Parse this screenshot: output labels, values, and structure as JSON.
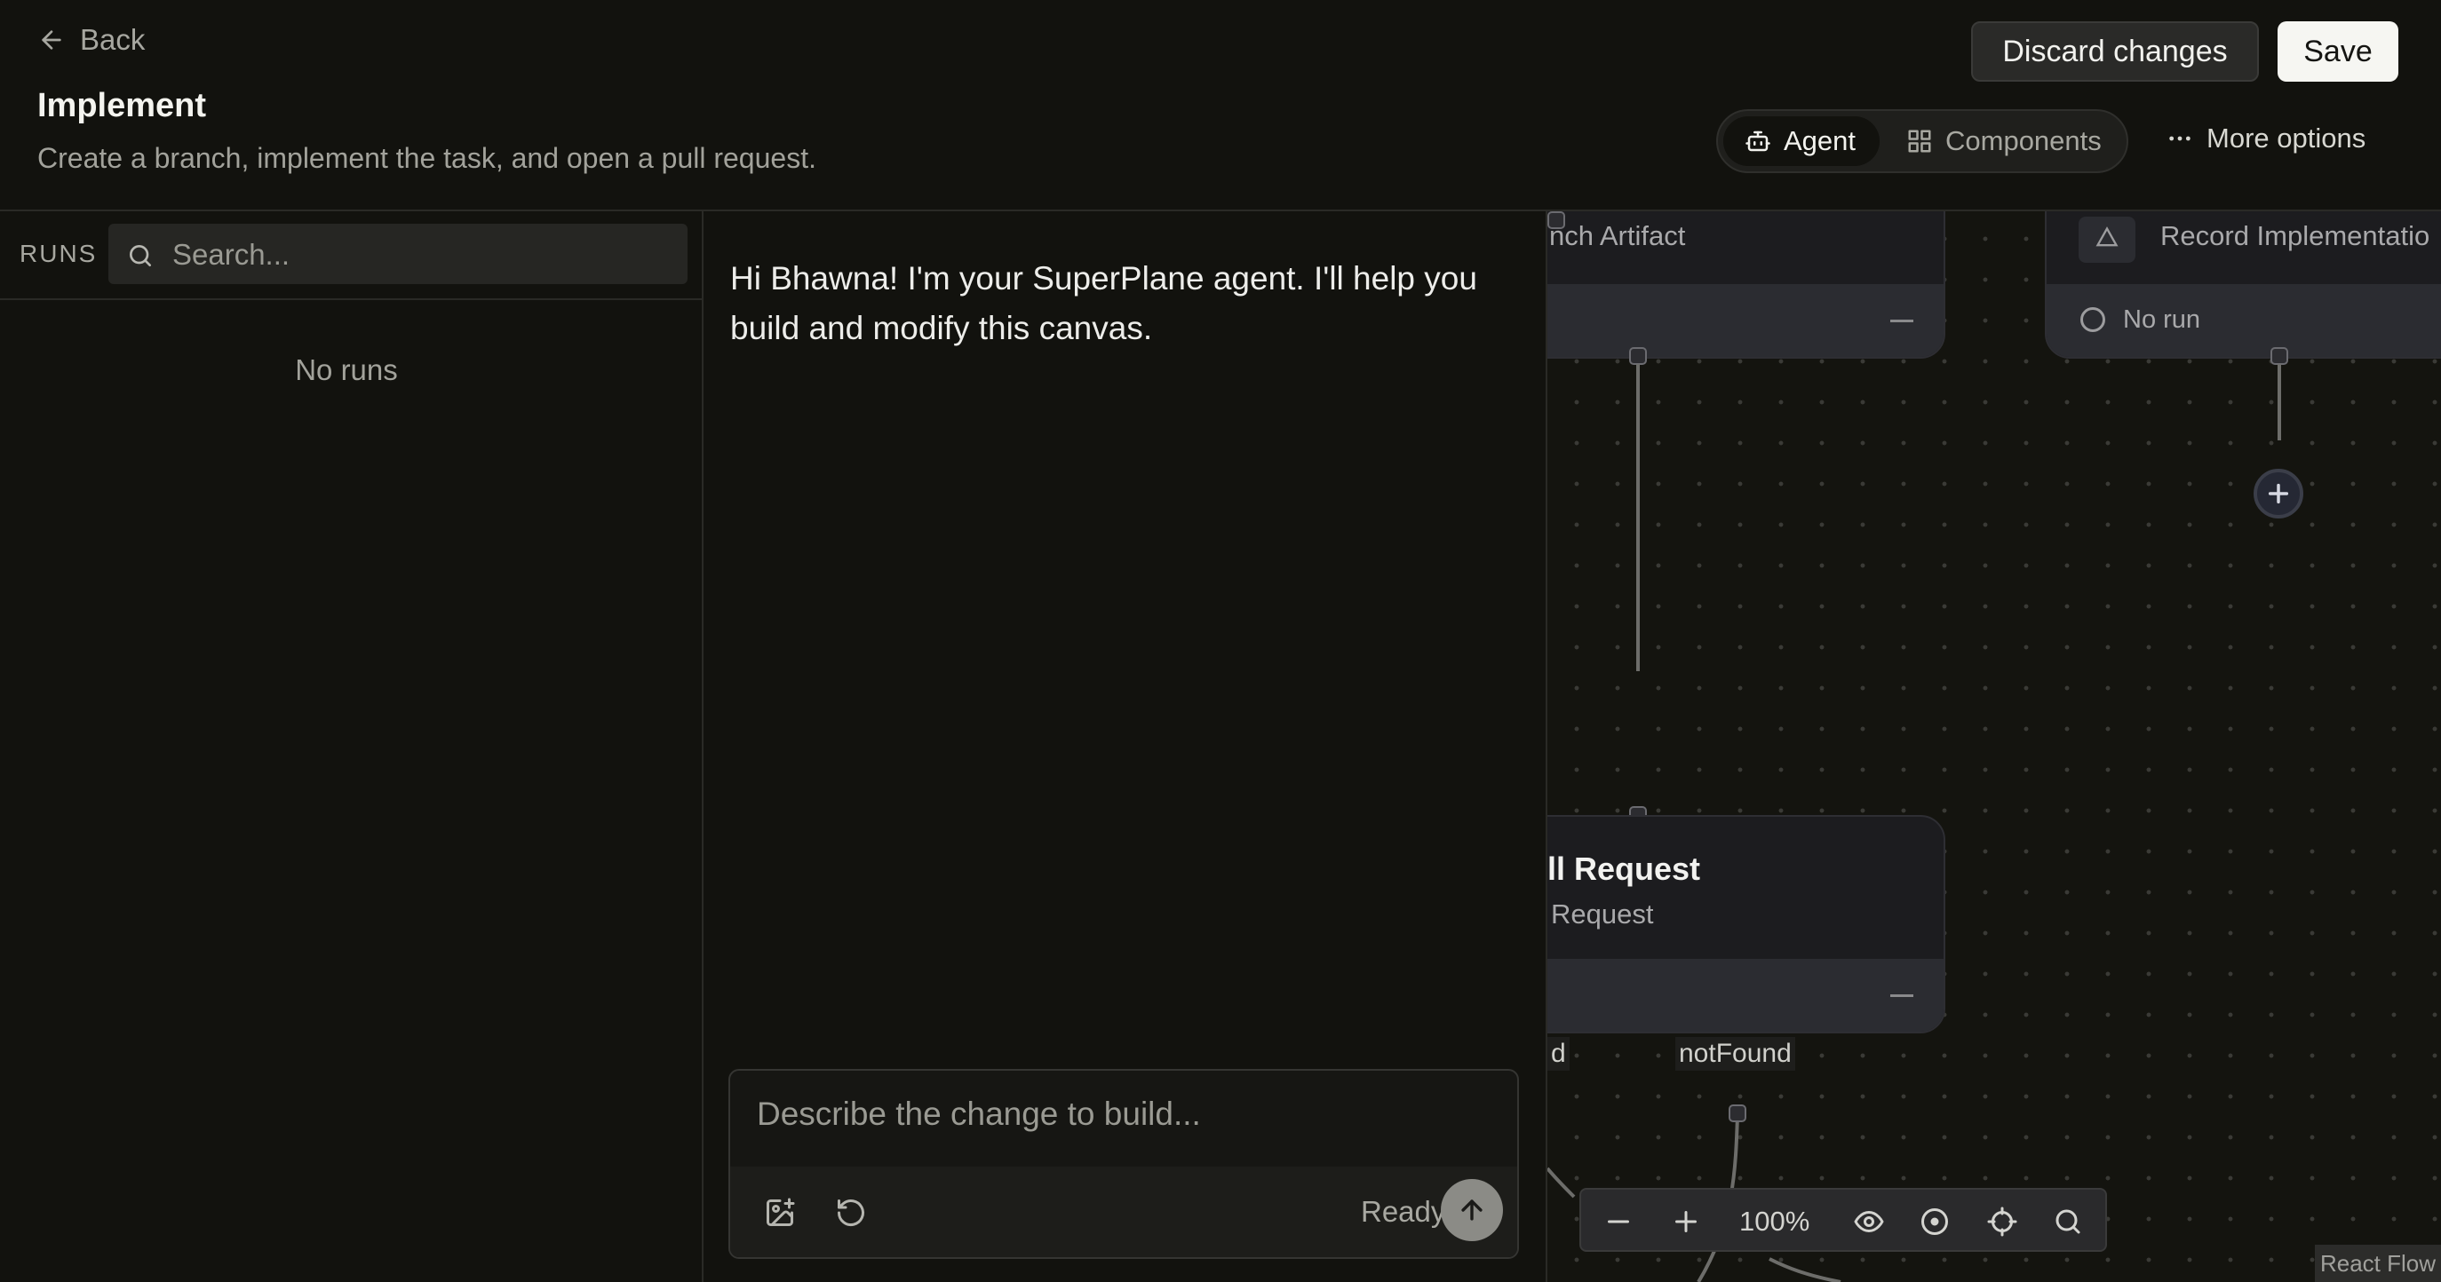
{
  "header": {
    "back_label": "Back",
    "title": "Implement",
    "subtitle": "Create a branch, implement the task, and open a pull request.",
    "discard_label": "Discard changes",
    "save_label": "Save",
    "tabs": [
      {
        "label": "Agent",
        "icon": "bot-icon",
        "active": true
      },
      {
        "label": "Components",
        "icon": "components-icon",
        "active": false
      }
    ],
    "more_label": "More options"
  },
  "runs": {
    "label": "RUNS",
    "search_placeholder": "Search...",
    "empty_text": "No runs"
  },
  "agent": {
    "message": "Hi Bhawna! I'm your SuperPlane agent. I'll help you build and modify this canvas.",
    "composer_placeholder": "Describe the change to build...",
    "status": "Ready"
  },
  "canvas": {
    "nodes": [
      {
        "subtitle": "nch Artifact",
        "footer": "—"
      },
      {
        "subtitle": "Record Implementatio",
        "status": "No run"
      },
      {
        "title": "ll Request",
        "subtitle": "Request",
        "footer": "—"
      }
    ],
    "edge_labels": [
      "d",
      "notFound"
    ],
    "zoom_level": "100%",
    "attribution": "React Flow"
  },
  "colors": {
    "background": "#12120e",
    "canvas_node": "#1c1c1f",
    "primary_button": "#f6f6f2"
  }
}
